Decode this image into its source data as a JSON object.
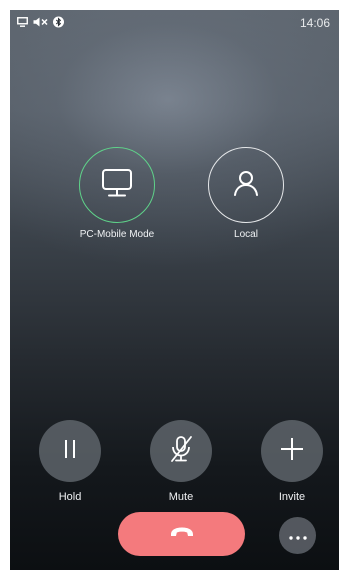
{
  "status_bar": {
    "icons": [
      "desktop-icon",
      "speaker-muted-icon",
      "bluetooth-icon"
    ],
    "time": "14:06"
  },
  "contacts": [
    {
      "label": "PC-Mobile Mode",
      "icon": "monitor-icon",
      "ring_color": "#5fd38a"
    },
    {
      "label": "Local",
      "icon": "person-icon",
      "ring_color": "#e6e8ea"
    }
  ],
  "actions": {
    "hold": {
      "label": "Hold",
      "icon": "pause-icon"
    },
    "mute": {
      "label": "Mute",
      "icon": "microphone-off-icon"
    },
    "invite": {
      "label": "Invite",
      "icon": "plus-icon"
    }
  },
  "call_controls": {
    "end_call": {
      "icon": "phone-hangup-icon",
      "color": "#f47a7d"
    },
    "more": {
      "icon": "more-dots-icon"
    }
  }
}
